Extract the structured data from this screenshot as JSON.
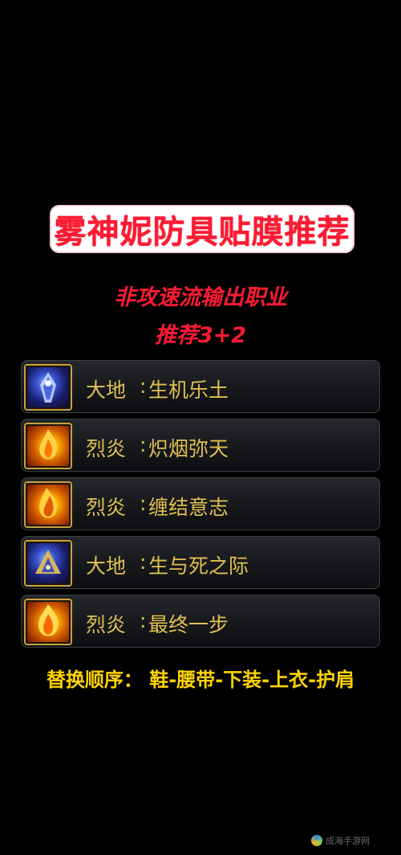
{
  "title": "雾神妮防具贴膜推荐",
  "subtitle_1": "非攻速流输出职业",
  "subtitle_2": "推荐3+2",
  "gear_items": [
    {
      "element": "大地",
      "separator": ":",
      "name": "生机乐土",
      "icon": "earth-emblem-icon"
    },
    {
      "element": "烈炎",
      "separator": ":",
      "name": "炽烟弥天",
      "icon": "flame-emblem-icon"
    },
    {
      "element": "烈炎",
      "separator": ":",
      "name": "缠结意志",
      "icon": "flame-emblem-icon"
    },
    {
      "element": "大地",
      "separator": ":",
      "name": "生与死之际",
      "icon": "earth-emblem-icon"
    },
    {
      "element": "烈炎",
      "separator": ":",
      "name": "最终一步",
      "icon": "flame-emblem-icon"
    }
  ],
  "replace_order": "替换顺序：  鞋-腰带-下装-上衣-护肩",
  "watermark": "成海手游网",
  "colors": {
    "background": "#000000",
    "title_red": "#ff1a33",
    "gear_text_gold": "#e0c050",
    "order_yellow": "#ffd400"
  }
}
